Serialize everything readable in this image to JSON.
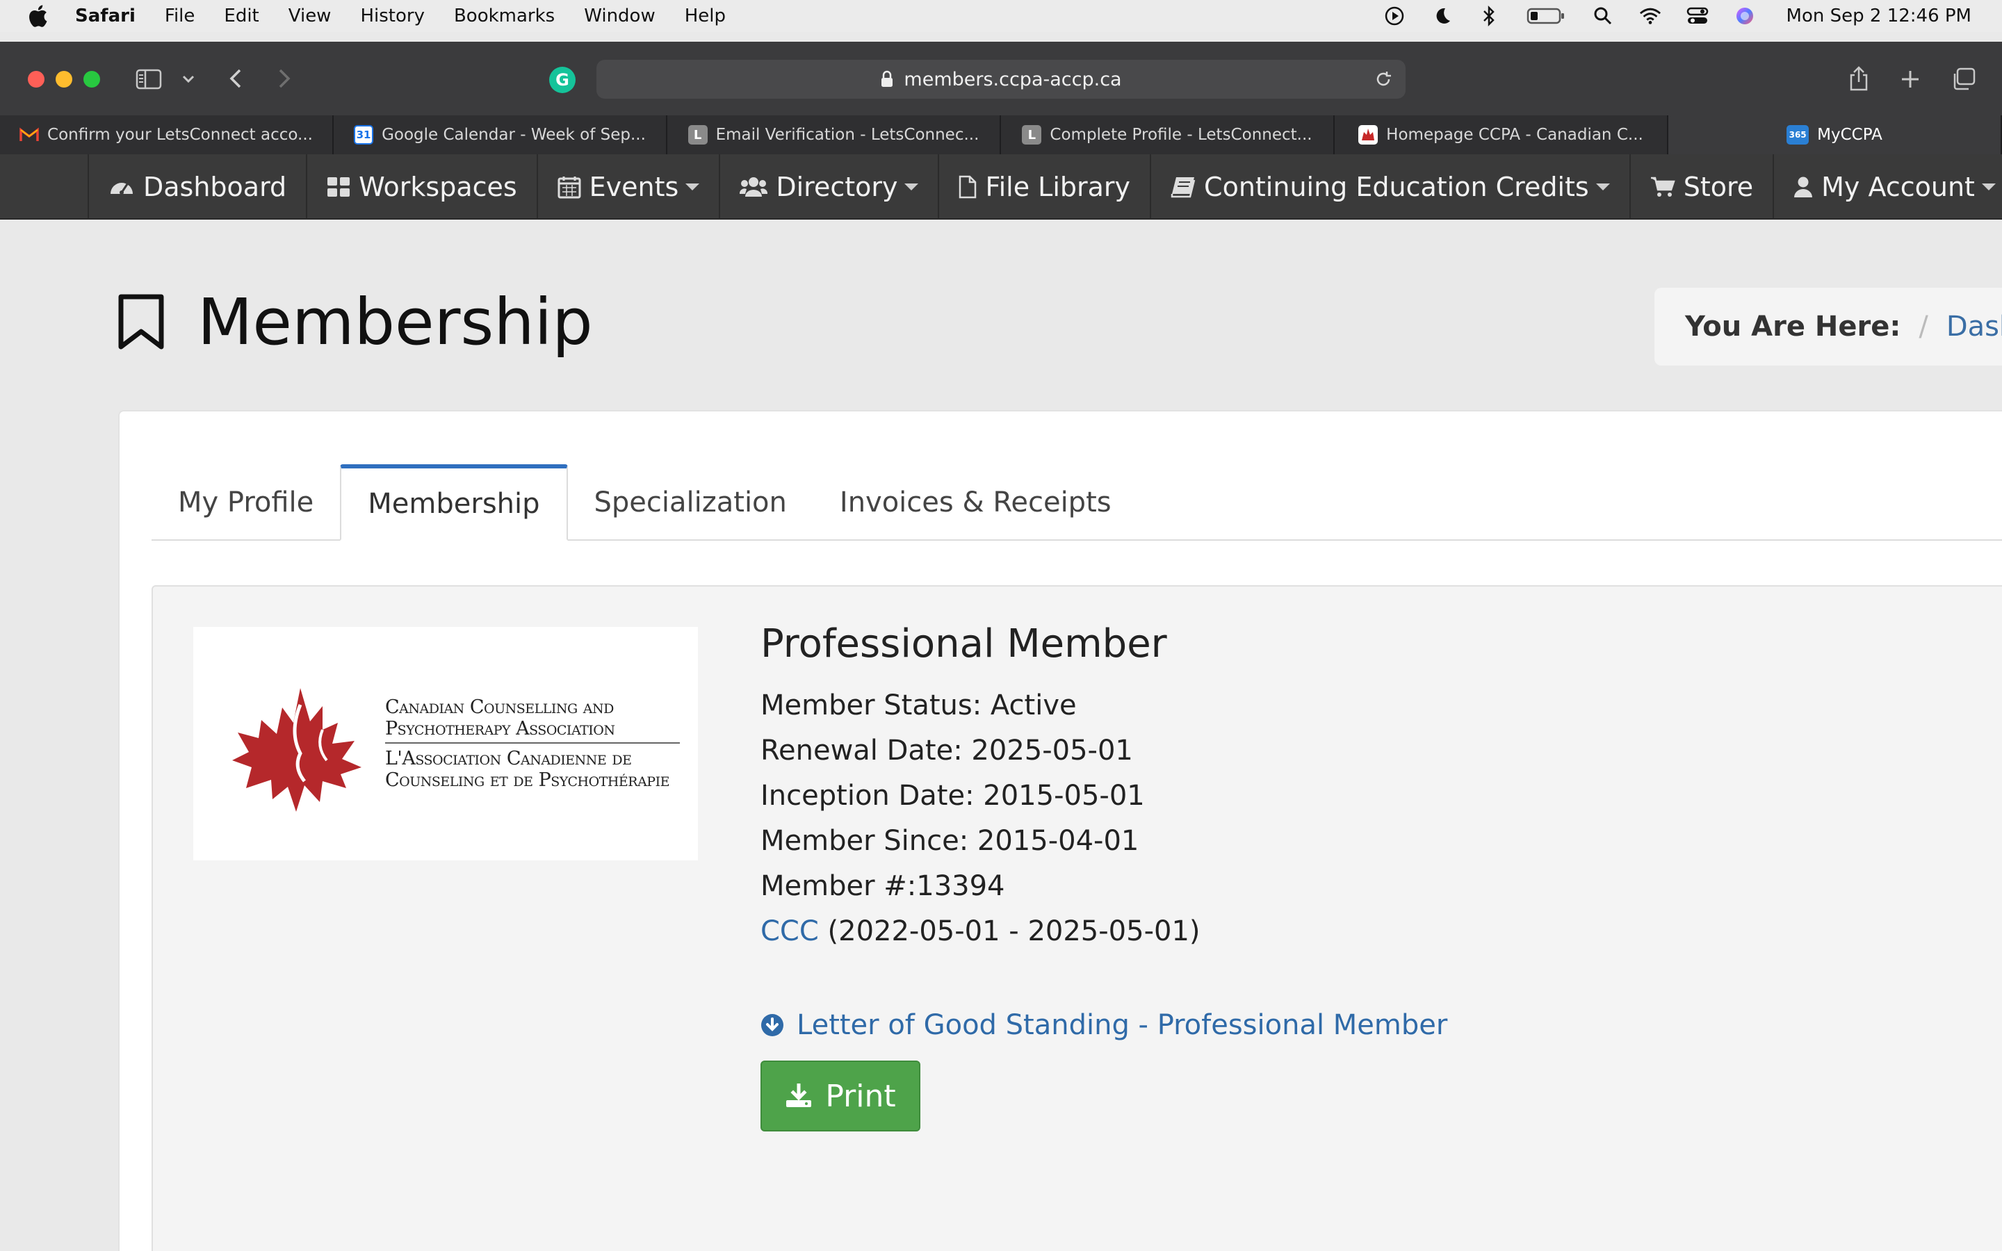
{
  "menubar": {
    "app": "Safari",
    "items": [
      "File",
      "Edit",
      "View",
      "History",
      "Bookmarks",
      "Window",
      "Help"
    ],
    "clock": "Mon Sep 2  12:46 PM",
    "status_icons": [
      "play-icon",
      "moon-icon",
      "bluetooth-icon",
      "battery-icon",
      "spotlight-icon",
      "wifi-icon",
      "control-center-icon",
      "siri-icon"
    ]
  },
  "browser": {
    "url": "members.ccpa-accp.ca",
    "tabs": [
      {
        "title": "Confirm your LetsConnect acco...",
        "favicon": "gmail-icon",
        "color": "#ea4335"
      },
      {
        "title": "Google Calendar - Week of Sep...",
        "favicon": "calendar-icon",
        "badge": "31",
        "color": "#1a73e8"
      },
      {
        "title": "Email Verification - LetsConnec...",
        "favicon": "letsconnect-icon",
        "badge": "L",
        "color": "#8a8a8a"
      },
      {
        "title": "Complete Profile - LetsConnect...",
        "favicon": "letsconnect-icon",
        "badge": "L",
        "color": "#8a8a8a"
      },
      {
        "title": "Homepage CCPA - Canadian C...",
        "favicon": "ccpa-icon",
        "color": "#c62828"
      },
      {
        "title": "MyCCPA",
        "favicon": "my365-icon",
        "badge": "365",
        "color": "#2a7fd4",
        "active": true
      }
    ]
  },
  "nav": [
    {
      "label": "Dashboard",
      "icon": "dashboard-icon"
    },
    {
      "label": "Workspaces",
      "icon": "grid-icon"
    },
    {
      "label": "Events",
      "icon": "calendar-icon",
      "dropdown": true
    },
    {
      "label": "Directory",
      "icon": "users-icon",
      "dropdown": true
    },
    {
      "label": "File Library",
      "icon": "file-icon"
    },
    {
      "label": "Continuing Education Credits",
      "icon": "book-icon",
      "dropdown": true
    },
    {
      "label": "Store",
      "icon": "cart-icon"
    },
    {
      "label": "My Account",
      "icon": "user-icon",
      "dropdown": true
    }
  ],
  "page": {
    "title": "Membership",
    "breadcrumb_label": "You Are Here:",
    "breadcrumb_sep": "/",
    "breadcrumb_link": "Dashbo"
  },
  "profile_tabs": [
    "My Profile",
    "Membership",
    "Specialization",
    "Invoices & Receipts"
  ],
  "logo": {
    "lines_en": [
      "Canadian Counselling and",
      "Psychotherapy Association"
    ],
    "lines_fr": [
      "L'Association Canadienne de",
      "Counseling et de Psychothérapie"
    ],
    "color": "#b5282b"
  },
  "membership": {
    "title": "Professional Member",
    "status": "Member Status: Active",
    "renewal": "Renewal Date: 2025-05-01",
    "inception": "Inception Date: 2015-05-01",
    "since": "Member Since: 2015-04-01",
    "number": "Member #:13394",
    "cert_link": "CCC",
    "cert_range": " (2022-05-01 - 2025-05-01)",
    "letter_link": "Letter of Good Standing - Professional Member",
    "print_label": "Print"
  },
  "colors": {
    "link": "#2f6aa8",
    "tab_accent": "#2f6fbf",
    "print_button": "#4ea34a",
    "nav_bg": "#3a3a3a"
  }
}
